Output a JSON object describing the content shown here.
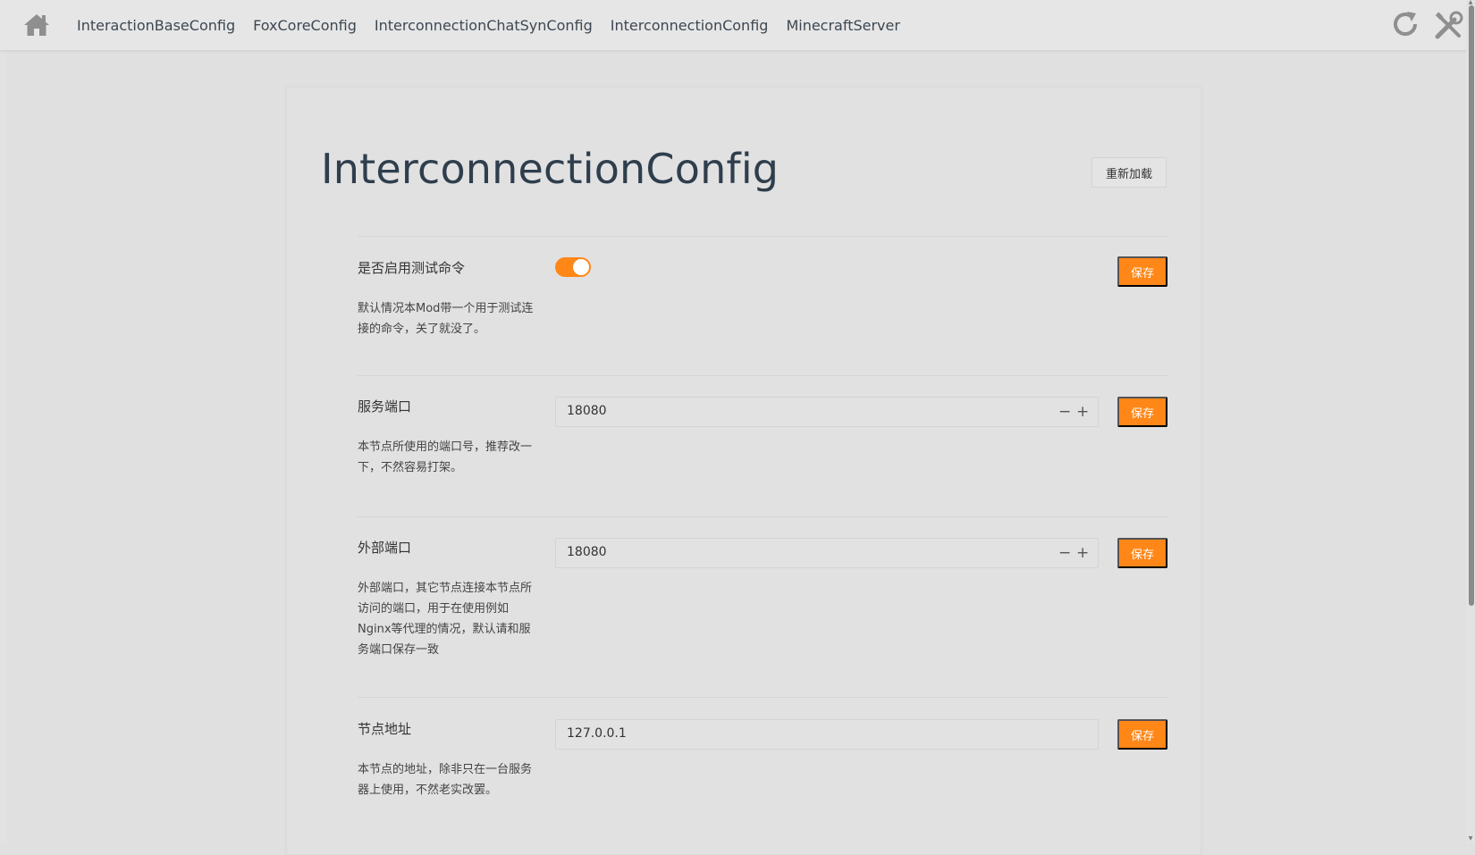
{
  "nav": {
    "items": [
      "InteractionBaseConfig",
      "FoxCoreConfig",
      "InterconnectionChatSynConfig",
      "InterconnectionConfig",
      "MinecraftServer"
    ],
    "icons": {
      "home": "home-icon",
      "refresh": "refresh-icon",
      "tools": "tools-icon"
    }
  },
  "page": {
    "title": "InterconnectionConfig",
    "reload_label": "重新加载"
  },
  "colors": {
    "accent": "#ff8717",
    "background": "#e0e0e0",
    "title": "#2f3e4d"
  },
  "settings": [
    {
      "label": "是否启用测试命令",
      "type": "toggle",
      "value": true,
      "description": "默认情况本Mod带一个用于测试连接的命令，关了就没了。",
      "save_label": "保存"
    },
    {
      "label": "服务端口",
      "type": "number",
      "value": "18080",
      "description": "本节点所使用的端口号，推荐改一下，不然容易打架。",
      "save_label": "保存"
    },
    {
      "label": "外部端口",
      "type": "number",
      "value": "18080",
      "description": "外部端口，其它节点连接本节点所访问的端口，用于在使用例如Nginx等代理的情况，默认请和服务端口保存一致",
      "save_label": "保存"
    },
    {
      "label": "节点地址",
      "type": "text",
      "value": "127.0.0.1",
      "description": "本节点的地址，除非只在一台服务器上使用，不然老实改罢。",
      "save_label": "保存"
    }
  ]
}
